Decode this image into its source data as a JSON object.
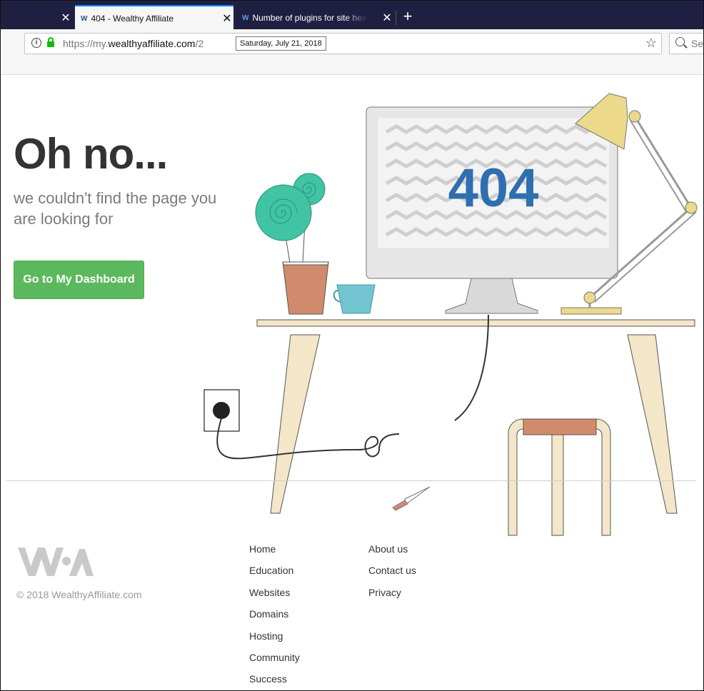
{
  "browser": {
    "tabs": [
      {
        "title": ""
      },
      {
        "title": "404 - Wealthy Affiliate",
        "favicon": "W"
      },
      {
        "title": "Number of plugins for site health",
        "favicon": "W"
      }
    ],
    "close_glyph": "✕",
    "new_tab_glyph": "+",
    "url_prefix": "https://my.",
    "url_host": "wealthyaffiliate.com",
    "url_path": "/2",
    "date_tooltip": "Saturday, July 21, 2018",
    "search_placeholder": "Search",
    "bookmark_glyph": "☆",
    "info_glyph": "i"
  },
  "page": {
    "headline": "Oh no...",
    "subline": "we couldn't find the page you are looking for",
    "dashboard_button": "Go to My Dashboard",
    "monitor_code": "404"
  },
  "footer": {
    "copyright": "© 2018 WealthyAffiliate.com",
    "col1": [
      "Home",
      "Education",
      "Websites",
      "Domains",
      "Hosting",
      "Community",
      "Success"
    ],
    "col2": [
      "About us",
      "Contact us",
      "Privacy"
    ]
  },
  "colors": {
    "tabstrip": "#1f2041",
    "button": "#5cb85c",
    "code": "#2f6fb0",
    "plant": "#40c4a4",
    "pot": "#d08b6d",
    "cup": "#72c4d0",
    "lamp": "#ecd98a",
    "wood": "#f3e6c9"
  }
}
